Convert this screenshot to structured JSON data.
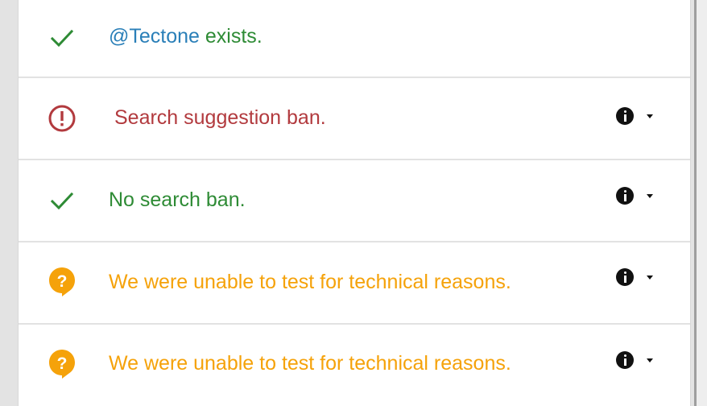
{
  "results": [
    {
      "status": "ok",
      "icon": "checkmark-icon",
      "mention": "@Tectone",
      "text": " exists.",
      "has_info": false
    },
    {
      "status": "ban",
      "icon": "alert-circle-icon",
      "text": "Search suggestion ban.",
      "has_info": true
    },
    {
      "status": "ok",
      "icon": "checkmark-icon",
      "text": "No search ban.",
      "has_info": true
    },
    {
      "status": "unknown",
      "icon": "question-bubble-icon",
      "text": "We were unable to test for technical reasons.",
      "has_info": true
    },
    {
      "status": "unknown",
      "icon": "question-bubble-icon",
      "text": "We were unable to test for technical reasons.",
      "has_info": true
    }
  ],
  "colors": {
    "ok": "#2e8b35",
    "ban": "#b23a3e",
    "unknown": "#f5a20a",
    "mention": "#2a7fb8",
    "info": "#111111"
  }
}
